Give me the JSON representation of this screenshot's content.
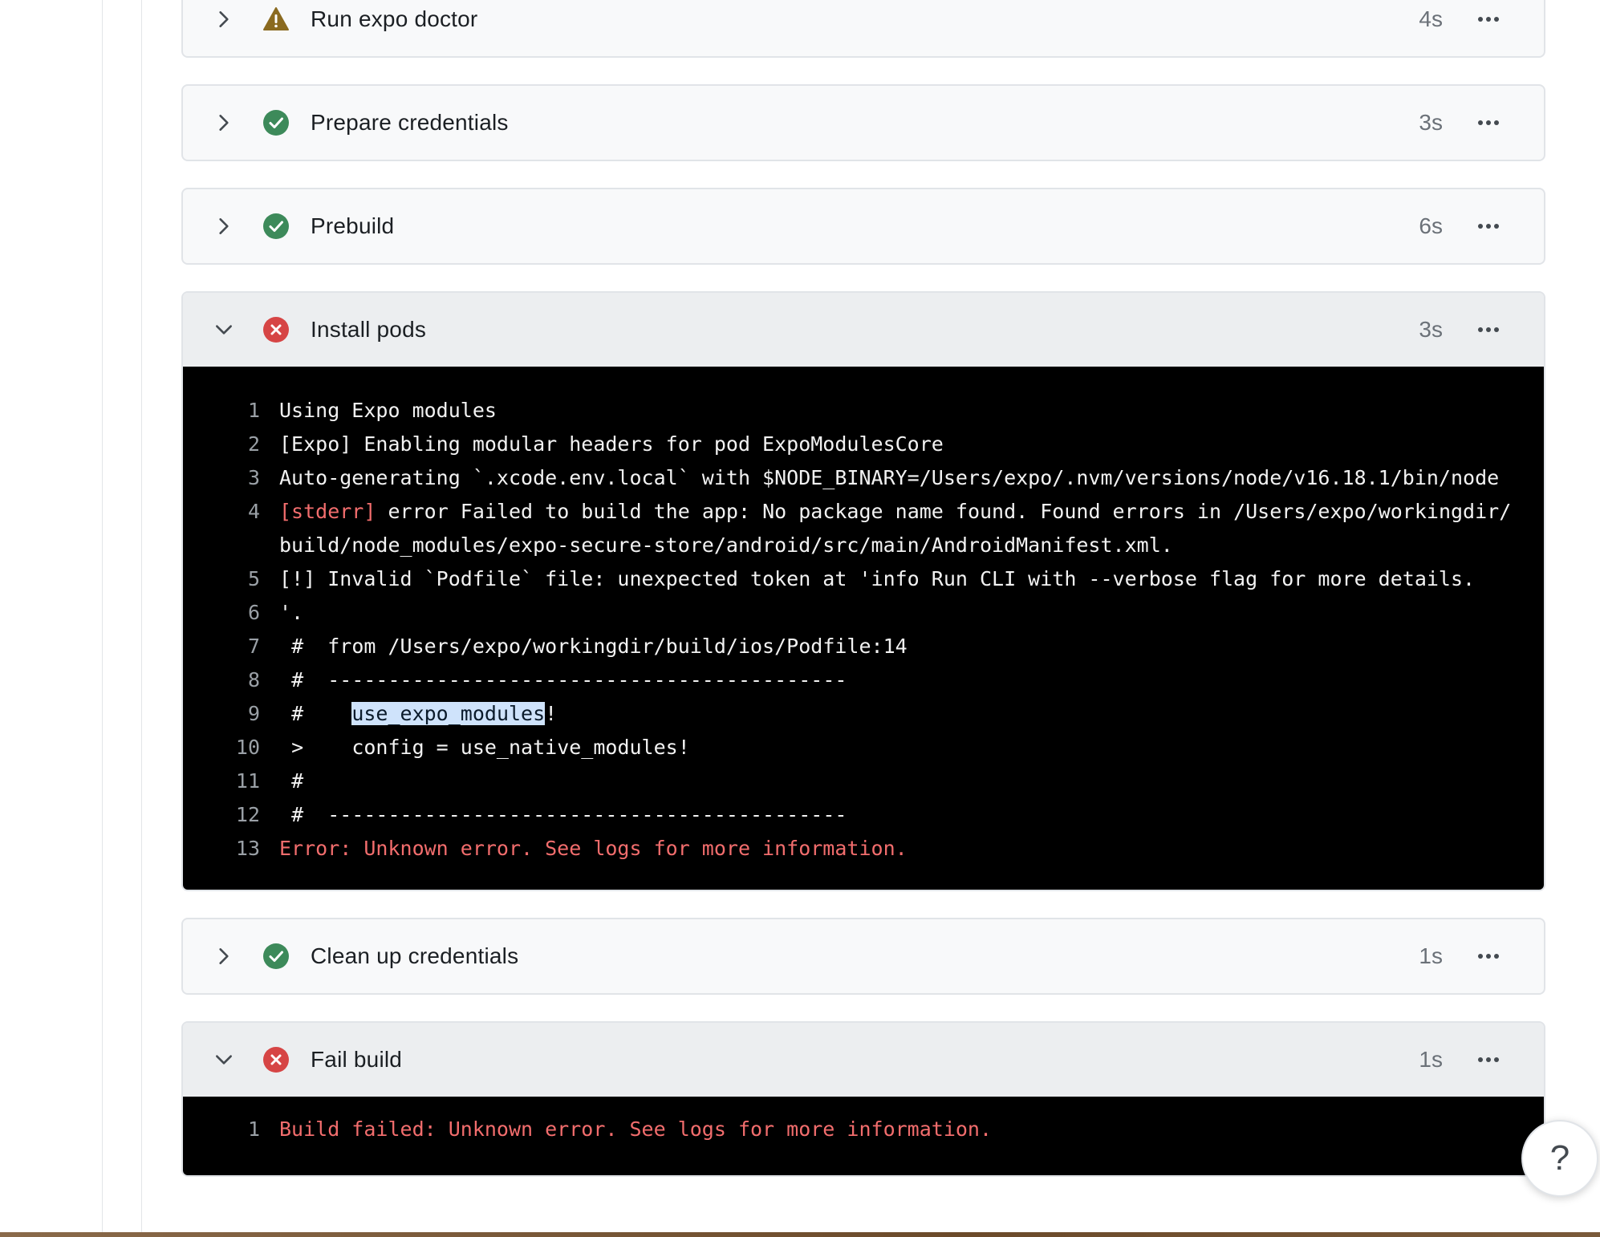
{
  "steps": [
    {
      "title": "Run expo doctor",
      "duration": "4s",
      "status": "warning",
      "status_icon": "warning-triangle-icon",
      "expanded": false
    },
    {
      "title": "Prepare credentials",
      "duration": "3s",
      "status": "success",
      "status_icon": "check-circle-icon",
      "expanded": false
    },
    {
      "title": "Prebuild",
      "duration": "6s",
      "status": "success",
      "status_icon": "check-circle-icon",
      "expanded": false
    },
    {
      "title": "Install pods",
      "duration": "3s",
      "status": "error",
      "status_icon": "x-circle-icon",
      "expanded": true
    },
    {
      "title": "Clean up credentials",
      "duration": "1s",
      "status": "success",
      "status_icon": "check-circle-icon",
      "expanded": false
    },
    {
      "title": "Fail build",
      "duration": "1s",
      "status": "error",
      "status_icon": "x-circle-icon",
      "expanded": true
    }
  ],
  "install_pods_log": [
    {
      "n": "1",
      "text": "Using Expo modules"
    },
    {
      "n": "2",
      "text": "[Expo] Enabling modular headers for pod ExpoModulesCore"
    },
    {
      "n": "3",
      "text": "Auto-generating `.xcode.env.local` with $NODE_BINARY=/Users/expo/.nvm/versions/node/v16.18.1/bin/node"
    },
    {
      "n": "4",
      "prefix": "[stderr]",
      "text": "error Failed to build the app: No package name found. Found errors in /Users/expo/workingdir/build/node_modules/expo-secure-store/android/src/main/AndroidManifest.xml."
    },
    {
      "n": "5",
      "text": "[!] Invalid `Podfile` file: unexpected token at 'info Run CLI with --verbose flag for more details."
    },
    {
      "n": "6",
      "text": "'."
    },
    {
      "n": "7",
      "text": " #  from /Users/expo/workingdir/build/ios/Podfile:14"
    },
    {
      "n": "8",
      "text": " #  -------------------------------------------"
    },
    {
      "n": "9",
      "pre": " #    ",
      "highlight": "use_expo_modules",
      "post": "!"
    },
    {
      "n": "10",
      "text": " >    config = use_native_modules!"
    },
    {
      "n": "11",
      "text": " #"
    },
    {
      "n": "12",
      "text": " #  -------------------------------------------"
    },
    {
      "n": "13",
      "text": "Error: Unknown error. See logs for more information.",
      "error": true
    }
  ],
  "fail_build_log": [
    {
      "n": "1",
      "text": "Build failed: Unknown error. See logs for more information.",
      "error": true
    }
  ],
  "help_button": {
    "label": "?"
  },
  "colors": {
    "success": "#3d8a5a",
    "warning": "#8a6a1f",
    "error": "#d64545",
    "log_error_text": "#f26d6d",
    "highlight": "#cfe3fb"
  }
}
